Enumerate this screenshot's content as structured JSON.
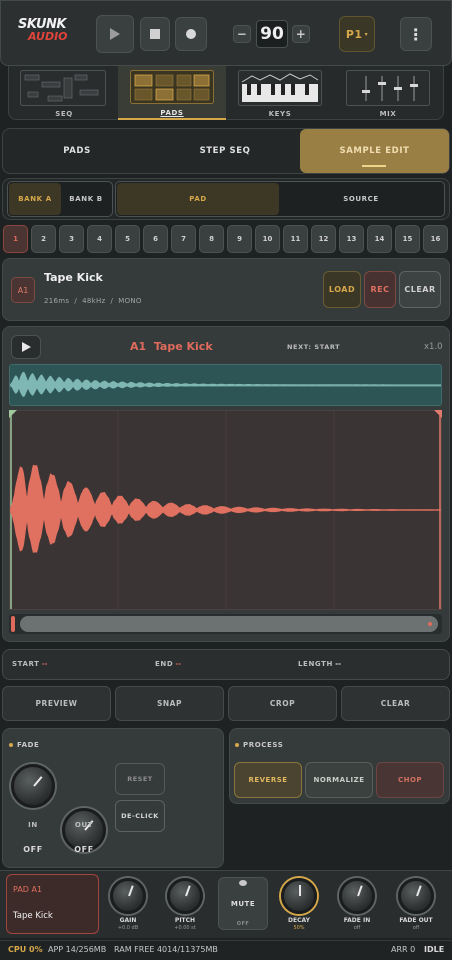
{
  "header": {
    "logo_line1": "SKUNK",
    "logo_line2": "AUDIO",
    "tempo": "90",
    "minus": "−",
    "plus": "+",
    "preset": "P1",
    "preset_caret": "▾",
    "menu": "⋮",
    "view_tabs": [
      {
        "label": "SEQ",
        "active": false
      },
      {
        "label": "PADS",
        "active": true
      },
      {
        "label": "KEYS",
        "active": false
      },
      {
        "label": "MIX",
        "active": false
      }
    ]
  },
  "mode_tabs": [
    {
      "label": "PADS",
      "active": false
    },
    {
      "label": "STEP SEQ",
      "active": false
    },
    {
      "label": "SAMPLE EDIT",
      "active": true
    }
  ],
  "bank_tabs": [
    {
      "label": "BANK A",
      "active": true
    },
    {
      "label": "BANK B",
      "active": false
    }
  ],
  "edit_target_tabs": [
    {
      "label": "PAD",
      "active": true
    },
    {
      "label": "SOURCE",
      "active": false
    }
  ],
  "pad_numbers": [
    "1",
    "2",
    "3",
    "4",
    "5",
    "6",
    "7",
    "8",
    "9",
    "10",
    "11",
    "12",
    "13",
    "14",
    "15",
    "16"
  ],
  "selected_pad": 1,
  "sample": {
    "pad_id": "A1",
    "name": "Tape Kick",
    "info": "216ms  /  48kHz  /  MONO",
    "load": "LOAD",
    "rec": "REC",
    "clear": "CLEAR"
  },
  "editor": {
    "title_id": "A1",
    "title_name": "Tape Kick",
    "next_label": "NEXT: START",
    "zoom": "x1.0"
  },
  "markers": {
    "start_label": "START",
    "start_value": "--",
    "end_label": "END",
    "end_value": "--",
    "length_label": "LENGTH",
    "length_value": "--"
  },
  "actions": [
    "PREVIEW",
    "SNAP",
    "CROP",
    "CLEAR"
  ],
  "fade": {
    "title": "FADE",
    "in_label": "IN",
    "out_label": "OUT",
    "in_value": "OFF",
    "out_value": "OFF",
    "reset": "RESET",
    "declick": "DE-CLICK"
  },
  "process": {
    "title": "PROCESS",
    "reverse": "REVERSE",
    "normalize": "NORMALIZE",
    "chop": "CHOP"
  },
  "pad_strip": {
    "pad_label": "PAD A1",
    "pad_name": "Tape Kick",
    "mute": "MUTE",
    "mute_state": "OFF",
    "knobs": [
      {
        "label": "GAIN",
        "value": "+0.0 dB",
        "highlight": false
      },
      {
        "label": "PITCH",
        "value": "+0.00 st",
        "highlight": false
      },
      {
        "label": "DECAY",
        "value": "50%",
        "highlight": true
      },
      {
        "label": "FADE IN",
        "value": "off",
        "highlight": false
      },
      {
        "label": "FADE OUT",
        "value": "off",
        "highlight": false
      }
    ]
  },
  "status": {
    "cpu": "CPU 0%",
    "app": "APP 14/256MB",
    "ram": "RAM FREE 4014/11375MB",
    "arr": "ARR 0",
    "state": "IDLE"
  },
  "colors": {
    "accent_gold": "#d6a84a",
    "accent_red": "#e06b5c",
    "wave_teal": "#7fb7b4"
  }
}
